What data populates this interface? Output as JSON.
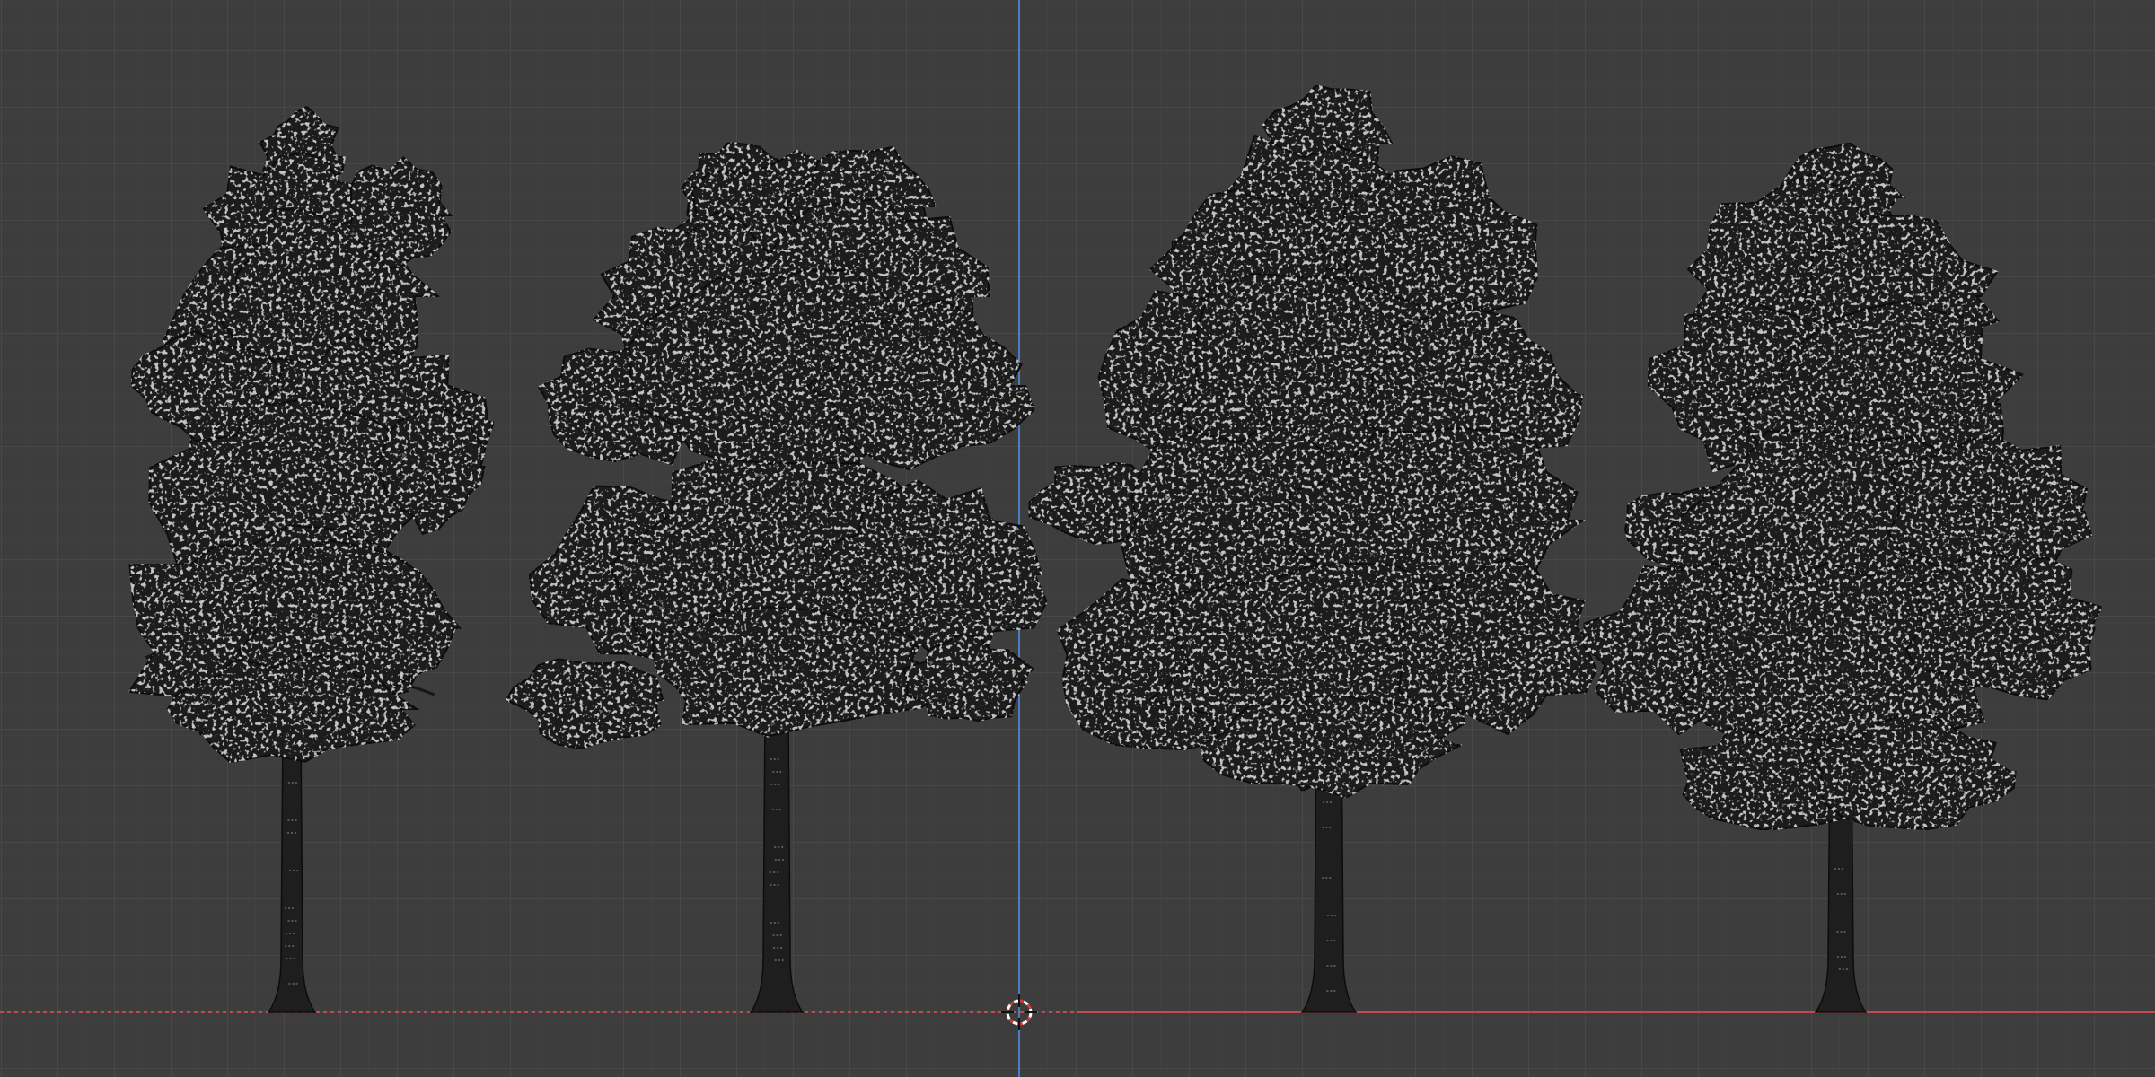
{
  "viewport": {
    "view": "front-orthographic",
    "background_color": "#3d3d3d",
    "grid_minor_color": "#474747",
    "grid_major_color": "#4d4d4d",
    "axis_x_color": "#c44a52",
    "axis_z_color": "#4a7fc4",
    "cursor_icon": "3d-cursor-icon"
  },
  "scene": {
    "object_type": "tree",
    "object_count": 4,
    "foliage_color": "#1b1b1b",
    "foliage_highlight": "#8a8a8a",
    "trunk_color": "#1e1e1e",
    "wire_color": "#0c0c0c"
  }
}
